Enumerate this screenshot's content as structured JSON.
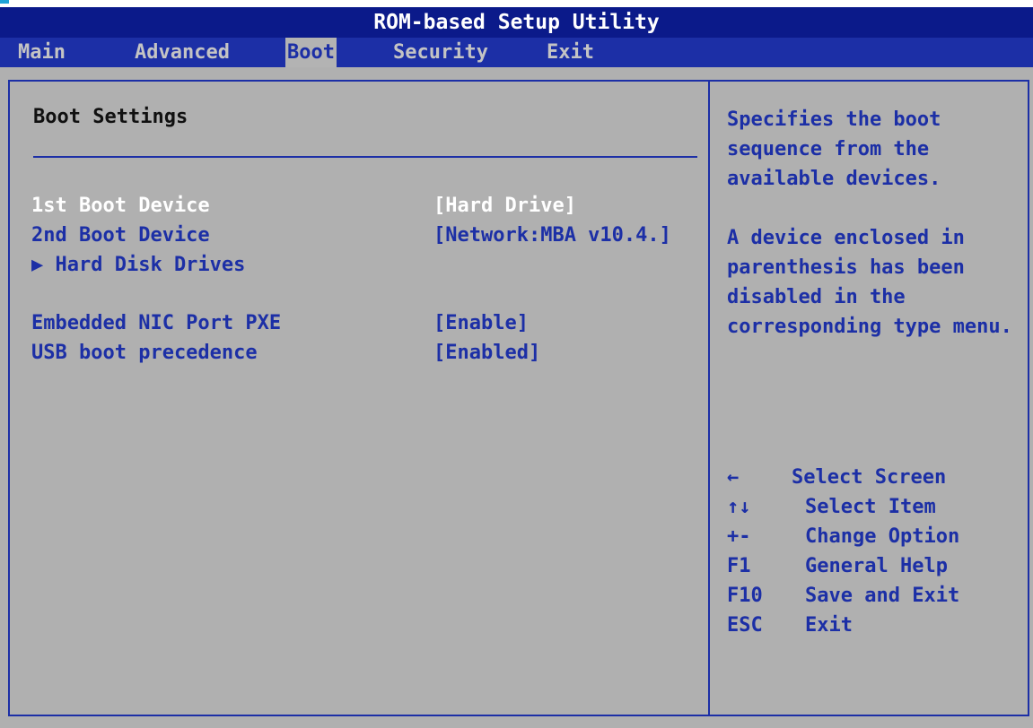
{
  "window": {
    "title": "ROM-based Setup Utility"
  },
  "menu": {
    "items": [
      {
        "label": "Main",
        "active": false
      },
      {
        "label": "Advanced",
        "active": false
      },
      {
        "label": "Boot",
        "active": true
      },
      {
        "label": "Security",
        "active": false
      },
      {
        "label": "Exit",
        "active": false
      }
    ]
  },
  "boot_settings": {
    "title": "Boot Settings",
    "items": [
      {
        "label": "1st Boot Device",
        "value": "[Hard Drive]",
        "selected": true
      },
      {
        "label": "2nd Boot Device",
        "value": "[Network:MBA v10.4.]",
        "selected": false
      },
      {
        "label": "▶ Hard Disk Drives",
        "value": "",
        "selected": false
      },
      {
        "label": "Embedded NIC Port PXE",
        "value": "[Enable]",
        "selected": false
      },
      {
        "label": "USB boot precedence",
        "value": "[Enabled]",
        "selected": false
      }
    ]
  },
  "help": {
    "paragraph1": "Specifies the boot sequence from the available devices.",
    "paragraph2": "A device enclosed in parenthesis has been disabled in the corresponding type menu.",
    "keys": [
      {
        "key": "←",
        "desc": "Select Screen"
      },
      {
        "key": "↑↓",
        "desc": "Select Item"
      },
      {
        "key": "+-",
        "desc": "Change Option"
      },
      {
        "key": "F1",
        "desc": "General Help"
      },
      {
        "key": "F10",
        "desc": "Save and Exit"
      },
      {
        "key": "ESC",
        "desc": "Exit"
      }
    ]
  },
  "colors": {
    "title_bar": "#0b1a8a",
    "menu_bar": "#1c2fa6",
    "panel_background": "#b0b0b0",
    "text_blue": "#1c2fa6",
    "text_selected": "#ffffff"
  }
}
